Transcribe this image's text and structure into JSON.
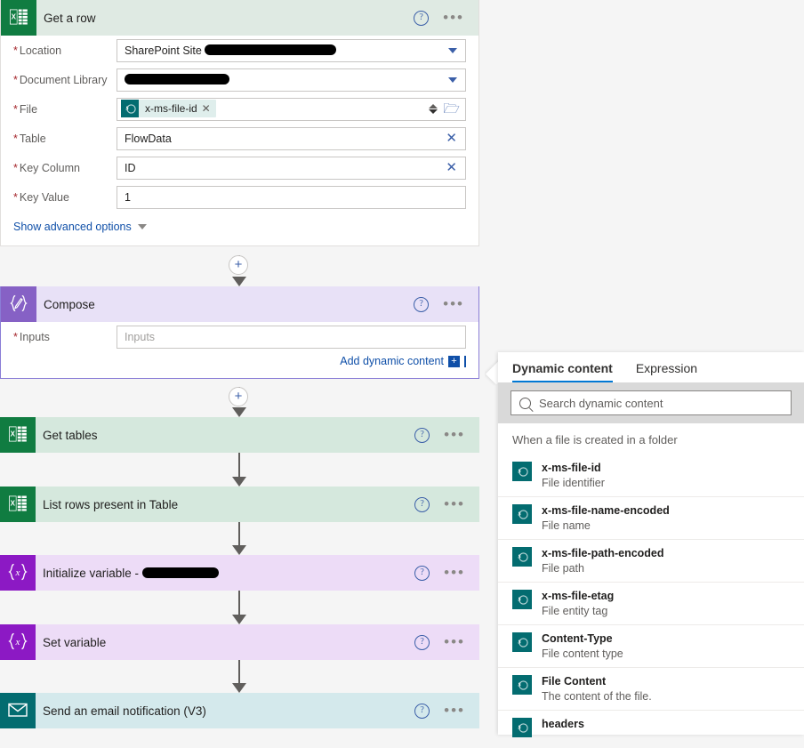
{
  "flow": {
    "steps": [
      {
        "id": "get-a-row",
        "title": "Get a row",
        "icon": "excel-icon",
        "icon_bg": "#107c41",
        "header_bg": "#dfeae3",
        "expanded": true,
        "fields": [
          {
            "label": "Location",
            "required": true,
            "type": "dropdown",
            "value": "SharePoint Site",
            "redacted": true,
            "redact_width": 148
          },
          {
            "label": "Document Library",
            "required": true,
            "type": "dropdown",
            "value": "",
            "redacted": true,
            "redact_width": 118
          },
          {
            "label": "File",
            "required": true,
            "type": "token",
            "token_text": "x-ms-file-id",
            "token_icon": "sharepoint-icon"
          },
          {
            "label": "Table",
            "required": true,
            "type": "clearable",
            "value": "FlowData"
          },
          {
            "label": "Key Column",
            "required": true,
            "type": "clearable",
            "value": "ID"
          },
          {
            "label": "Key Value",
            "required": true,
            "type": "text",
            "value": "1"
          }
        ],
        "advanced_label": "Show advanced options"
      },
      {
        "id": "compose",
        "title": "Compose",
        "icon": "compose-braces-icon",
        "icon_bg": "#8661c5",
        "header_bg": "#e8e1f7",
        "expanded": true,
        "selected": true,
        "fields": [
          {
            "label": "Inputs",
            "required": true,
            "type": "text",
            "value": "",
            "placeholder": "Inputs"
          }
        ],
        "add_dynamic_content": "Add dynamic content"
      },
      {
        "id": "get-tables",
        "title": "Get tables",
        "icon": "excel-icon",
        "icon_bg": "#107c41",
        "header_bg": "#d5e8dd",
        "expanded": false
      },
      {
        "id": "list-rows-present-in-table",
        "title": "List rows present in Table",
        "icon": "excel-icon",
        "icon_bg": "#107c41",
        "header_bg": "#d5e8dd",
        "expanded": false
      },
      {
        "id": "initialize-variable",
        "title": "Initialize variable -",
        "icon": "variable-icon",
        "icon_bg": "#8c19c4",
        "header_bg": "#eddcf7",
        "expanded": false,
        "redacted": true,
        "redact_width": 86
      },
      {
        "id": "set-variable",
        "title": "Set variable",
        "icon": "variable-icon",
        "icon_bg": "#8c19c4",
        "header_bg": "#eddcf7",
        "expanded": false
      },
      {
        "id": "send-an-email-notification-v3",
        "title": "Send an email notification (V3)",
        "icon": "mail-icon",
        "icon_bg": "#036c70",
        "header_bg": "#d4e9ec",
        "expanded": false
      }
    ],
    "help_glyph": "?",
    "more_glyph": "•••",
    "plus_glyph": "+"
  },
  "dynamic_content_panel": {
    "tabs": [
      {
        "label": "Dynamic content",
        "active": true
      },
      {
        "label": "Expression",
        "active": false
      }
    ],
    "search": {
      "placeholder": "Search dynamic content",
      "value": "",
      "icon": "search-icon"
    },
    "group_label": "When a file is created in a folder",
    "items": [
      {
        "name": "x-ms-file-id",
        "desc": "File identifier",
        "icon": "sharepoint-icon"
      },
      {
        "name": "x-ms-file-name-encoded",
        "desc": "File name",
        "icon": "sharepoint-icon"
      },
      {
        "name": "x-ms-file-path-encoded",
        "desc": "File path",
        "icon": "sharepoint-icon"
      },
      {
        "name": "x-ms-file-etag",
        "desc": "File entity tag",
        "icon": "sharepoint-icon"
      },
      {
        "name": "Content-Type",
        "desc": "File content type",
        "icon": "sharepoint-icon"
      },
      {
        "name": "File Content",
        "desc": "The content of the file.",
        "icon": "sharepoint-icon"
      },
      {
        "name": "headers",
        "desc": "",
        "icon": "sharepoint-icon"
      }
    ]
  },
  "colors": {
    "accent_blue": "#0078d4",
    "link_blue": "#0f4fa8",
    "excel_green": "#107c41",
    "sharepoint_teal": "#036c70",
    "variable_purple": "#8c19c4",
    "compose_purple": "#8661c5",
    "required_red": "#a4262c"
  }
}
